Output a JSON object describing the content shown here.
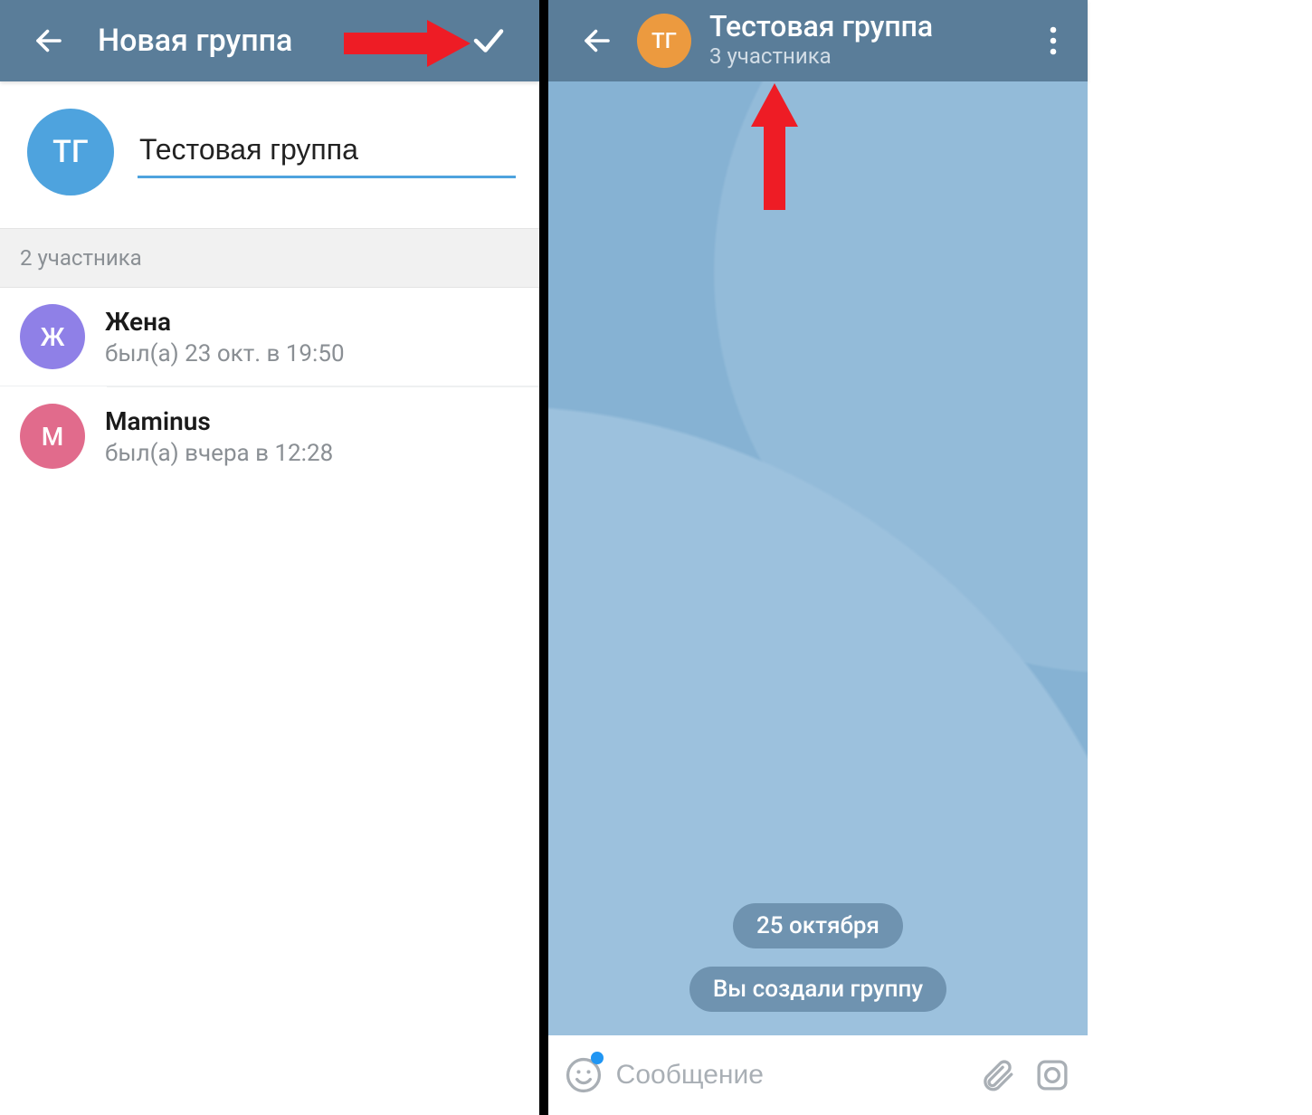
{
  "left": {
    "title": "Новая группа",
    "group_avatar_initials": "ТГ",
    "group_name_input": "Тестовая группа",
    "members_header": "2 участника",
    "members": [
      {
        "initial": "Ж",
        "color": "c-purple",
        "name": "Жена",
        "status": "был(а) 23 окт. в 19:50"
      },
      {
        "initial": "M",
        "color": "c-pink",
        "name": "Maminus",
        "status": "был(а) вчера в 12:28"
      }
    ]
  },
  "right": {
    "group_avatar_initials": "ТГ",
    "group_name": "Тестовая группа",
    "group_subtitle": "3 участника",
    "date_pill": "25 октября",
    "system_pill": "Вы создали группу",
    "composer_placeholder": "Сообщение"
  },
  "colors": {
    "topbar": "#5a7d99",
    "accent": "#4ea3de",
    "annotation": "#ee1c25"
  }
}
